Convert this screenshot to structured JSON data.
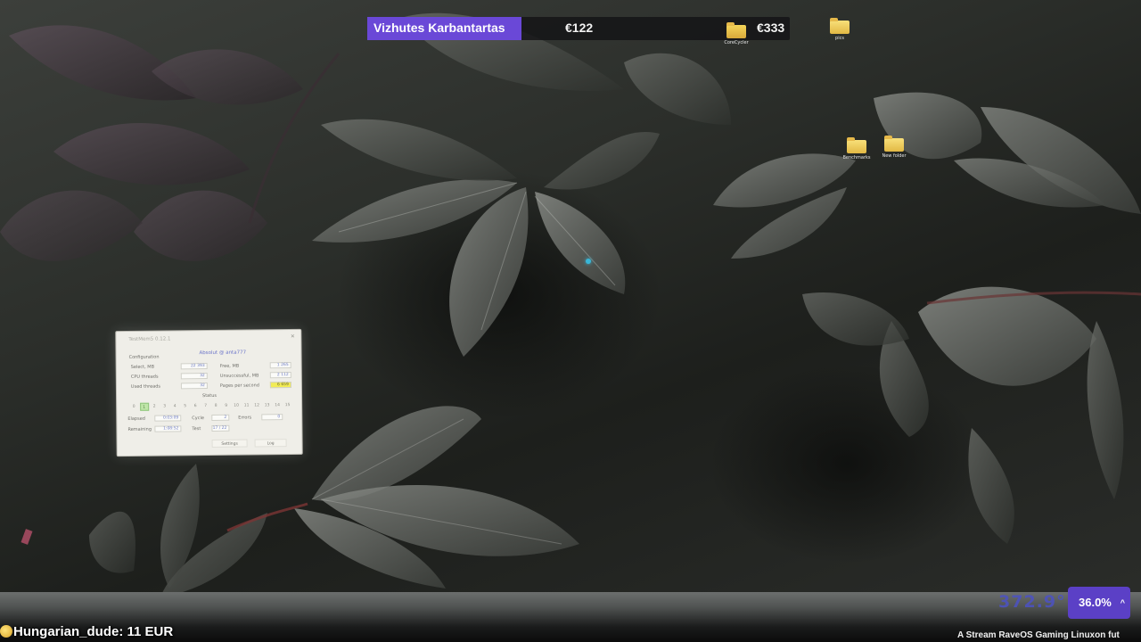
{
  "goal": {
    "title": "Vizhutes Karbantartas",
    "current": "€122",
    "target": "€333",
    "progress": 0.366
  },
  "desktop": {
    "icons": [
      {
        "name": "folder",
        "label": "CoreCycler"
      },
      {
        "name": "folder",
        "label": "pics"
      },
      {
        "name": "folder",
        "label": "Benchmarks"
      },
      {
        "name": "folder",
        "label": "New folder"
      }
    ]
  },
  "miner_window": {
    "title": "TestMem5 0.12.1",
    "config_label": "Configuration",
    "profile": "Absolut @ anta777",
    "rows": [
      {
        "label": "Select, MB",
        "value": "22 393",
        "label2": "Free, MB",
        "value2": "1 265"
      },
      {
        "label": "CPU threads",
        "value": "32",
        "label2": "Unsuccessful, MB",
        "value2": "2 112"
      },
      {
        "label": "Used threads",
        "value": "32",
        "label2": "Pages per second",
        "value2": "6 659"
      }
    ],
    "status_label": "Status",
    "cells": [
      "0",
      "1",
      "2",
      "3",
      "4",
      "5",
      "6",
      "7",
      "8",
      "9",
      "10",
      "11",
      "12",
      "13",
      "14",
      "15"
    ],
    "active_cell": 1,
    "stats": [
      {
        "label": "Elapsed",
        "value": "0:03:09",
        "label2": "Cycle",
        "value2": "2",
        "label3": "Errors",
        "value3": "0"
      },
      {
        "label": "Remaining",
        "value": "1:08:52",
        "label2": "Test",
        "value2": "17 / 22"
      }
    ],
    "buttons": {
      "settings": "Settings",
      "log": "Log"
    }
  },
  "hud": {
    "number": "372.9°",
    "percent": "36.0%",
    "percent_icon": "chevron-up-icon",
    "accent": "#5b40c6"
  },
  "stream": {
    "donation_icon": "coin-icon",
    "donation_text": "Hungarian_dude: 11 EUR",
    "ticker": "A Stream RaveOS Gaming Linuxon fut"
  }
}
